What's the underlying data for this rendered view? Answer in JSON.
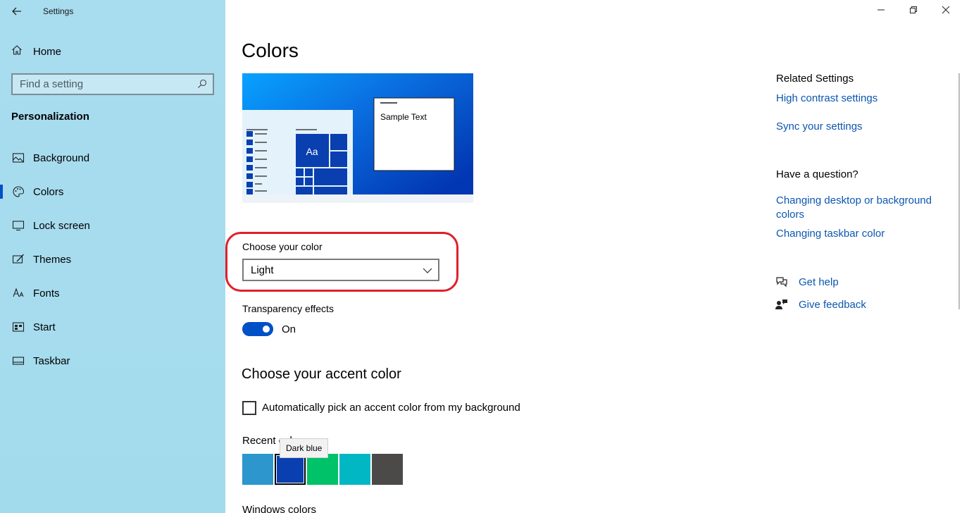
{
  "window": {
    "title": "Settings",
    "controls": [
      "minimize",
      "restore",
      "close"
    ]
  },
  "nav": {
    "home_label": "Home",
    "search_placeholder": "Find a setting",
    "section_title": "Personalization",
    "items": [
      {
        "label": "Background",
        "icon": "picture-icon",
        "selected": false
      },
      {
        "label": "Colors",
        "icon": "palette-icon",
        "selected": true
      },
      {
        "label": "Lock screen",
        "icon": "monitor-icon",
        "selected": false
      },
      {
        "label": "Themes",
        "icon": "brush-icon",
        "selected": false
      },
      {
        "label": "Fonts",
        "icon": "font-icon",
        "selected": false
      },
      {
        "label": "Start",
        "icon": "start-grid-icon",
        "selected": false
      },
      {
        "label": "Taskbar",
        "icon": "taskbar-icon",
        "selected": false
      }
    ]
  },
  "main": {
    "title": "Colors",
    "preview": {
      "sample_text": "Sample Text",
      "tile_text": "Aa"
    },
    "color_mode": {
      "label": "Choose your color",
      "value": "Light"
    },
    "transparency": {
      "label": "Transparency effects",
      "state": "On",
      "enabled": true
    },
    "accent": {
      "heading": "Choose your accent color",
      "auto_pick_label": "Automatically pick an accent color from my background",
      "auto_pick_checked": false,
      "recent_label": "Recent colors",
      "tooltip": "Dark blue",
      "recent_colors": [
        {
          "name": "Light blue",
          "hex": "#2d96cc",
          "selected": false
        },
        {
          "name": "Dark blue",
          "hex": "#0a3fb0",
          "selected": true
        },
        {
          "name": "Green",
          "hex": "#00c268",
          "selected": false
        },
        {
          "name": "Teal",
          "hex": "#00b7c3",
          "selected": false
        },
        {
          "name": "Gray",
          "hex": "#4c4a48",
          "selected": false
        }
      ],
      "next_label": "Windows colors"
    }
  },
  "related": {
    "heading": "Related Settings",
    "links": [
      "High contrast settings",
      "Sync your settings"
    ],
    "question_heading": "Have a question?",
    "question_links": [
      "Changing desktop or background colors",
      "Changing taskbar color"
    ],
    "help": [
      {
        "label": "Get help",
        "icon": "help-chat-icon"
      },
      {
        "label": "Give feedback",
        "icon": "feedback-icon"
      }
    ]
  },
  "colors": {
    "accent": "#0050c8",
    "link": "#0b56b0",
    "highlight_ring": "#e0202c"
  }
}
